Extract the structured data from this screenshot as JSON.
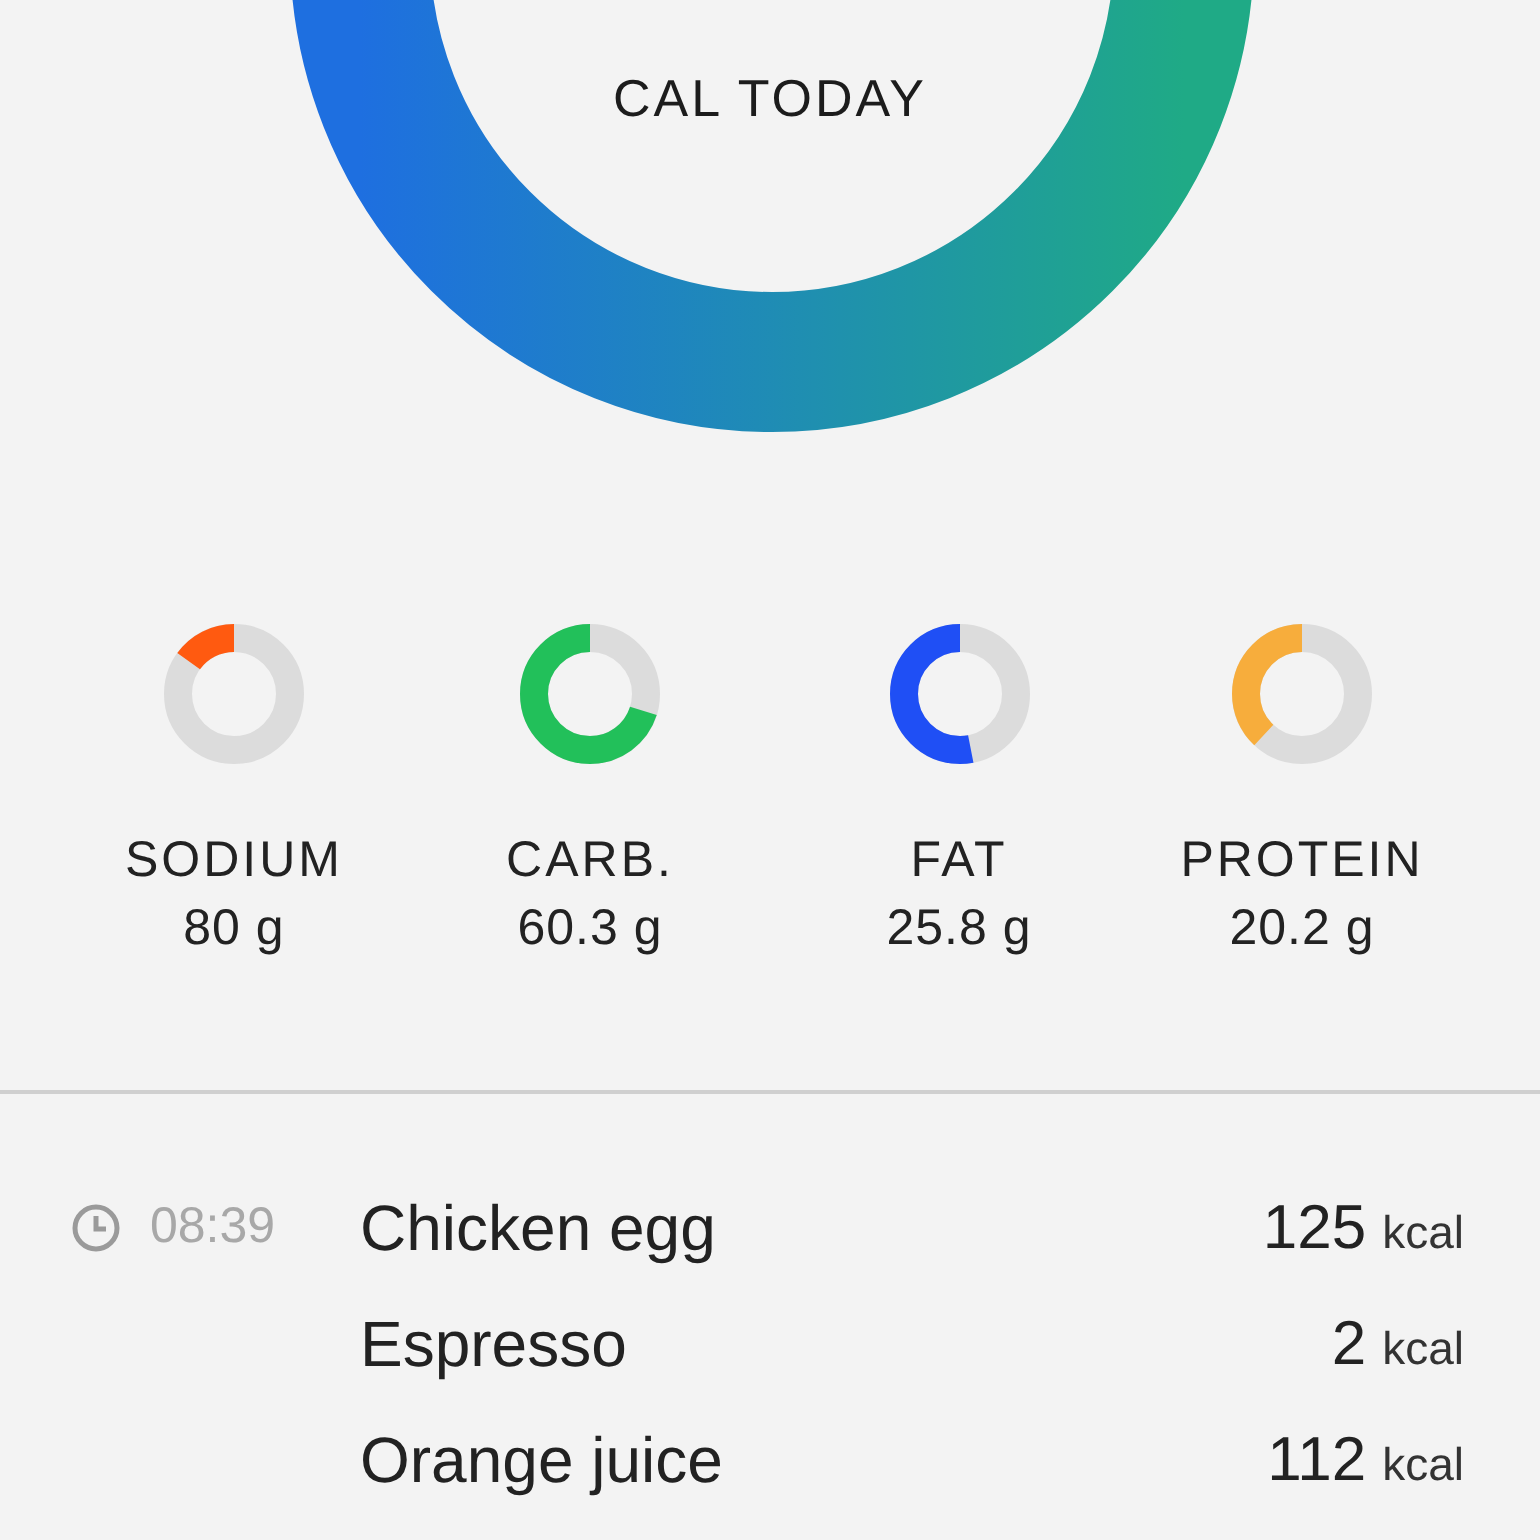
{
  "calories": {
    "caption": "CAL TODAY"
  },
  "nutrients": [
    {
      "name": "SODIUM",
      "value": "80 g",
      "level": 0.15,
      "color": "#ff5a10"
    },
    {
      "name": "CARB.",
      "value": "60.3 g",
      "level": 0.7,
      "color": "#22c05a"
    },
    {
      "name": "FAT",
      "value": "25.8 g",
      "level": 0.53,
      "color": "#1f4ff5"
    },
    {
      "name": "PROTEIN",
      "value": "20.2 g",
      "level": 0.38,
      "color": "#f7ad3c"
    }
  ],
  "meals": [
    {
      "time": "08:39",
      "name": "Chicken egg",
      "amount": "125",
      "unit": "kcal"
    },
    {
      "name": "Espresso",
      "amount": "2",
      "unit": "kcal"
    },
    {
      "name": "Orange juice",
      "amount": "112",
      "unit": "kcal"
    }
  ]
}
